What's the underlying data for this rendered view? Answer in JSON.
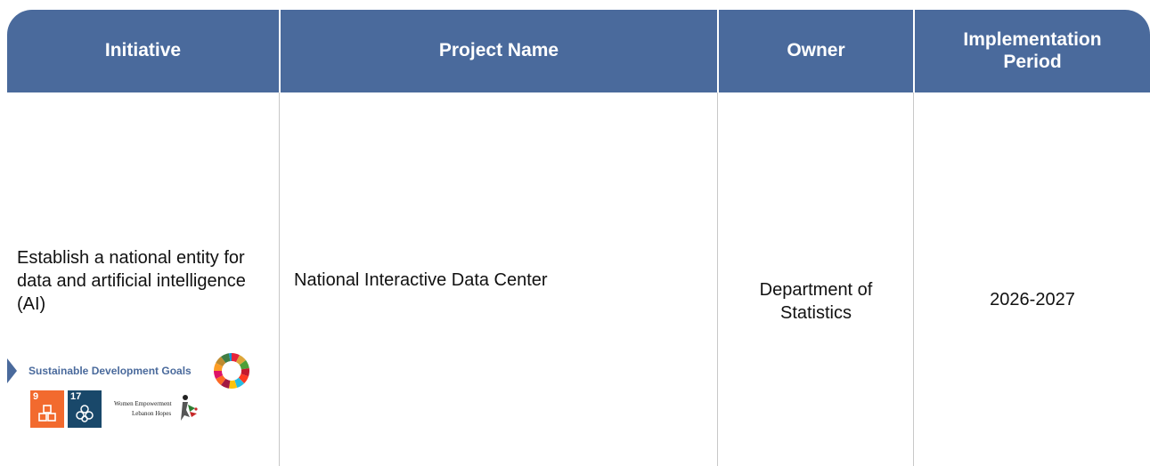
{
  "table": {
    "headers": {
      "initiative": "Initiative",
      "project_name": "Project Name",
      "owner": "Owner",
      "implementation_period": "Implementation Period"
    },
    "row": {
      "initiative": "Establish a national entity for data and artificial intelligence (AI)",
      "project_name": "National Interactive Data Center",
      "owner": "Department of Statistics",
      "implementation_period": "2026-2027"
    }
  },
  "sdg": {
    "label": "Sustainable Development Goals",
    "goals": [
      {
        "number": "9",
        "color": "#f26a2e"
      },
      {
        "number": "17",
        "color": "#19486a"
      }
    ],
    "women_empowerment_lines": [
      "Women Empowerment",
      "Lebanon Hopes"
    ]
  },
  "colors": {
    "header_bg": "#4a6a9c",
    "accent": "#4a6a9c",
    "grid": "#c8c8c8"
  }
}
